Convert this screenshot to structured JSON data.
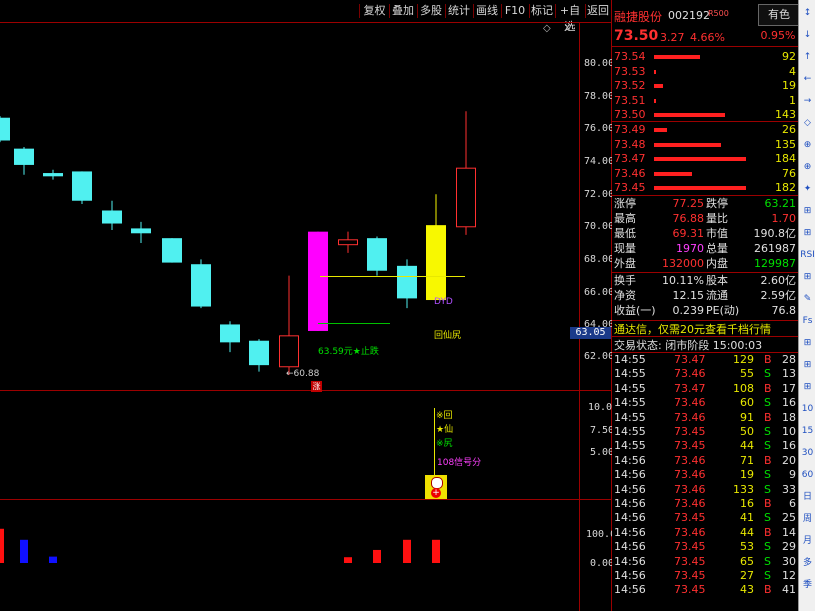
{
  "toolbar": {
    "items": [
      "复权",
      "叠加",
      "多股",
      "统计",
      "画线",
      "F10",
      "标记",
      "+自选",
      "返回"
    ],
    "diamond": "◇",
    "close": "X"
  },
  "price_axis": {
    "ticks": [
      "80.00",
      "78.00",
      "76.00",
      "74.00",
      "72.00",
      "70.00",
      "68.00",
      "66.00",
      "64.00",
      "62.00"
    ],
    "current_tag": "63.05"
  },
  "indicator_axis": {
    "ticks": [
      "10.00",
      "7.50",
      "5.00"
    ]
  },
  "volume_axis": {
    "ticks": [
      "100.0",
      "0.00"
    ]
  },
  "annotations": {
    "low_price": "←60.88",
    "zhang": "涨",
    "stop_label": "63.59元★止跌",
    "pattern_label": "回仙尻",
    "dyd": "DYD",
    "signal_lines": [
      "※回",
      "★仙",
      "※尻"
    ],
    "signal_count": "108信号分"
  },
  "chart_data": {
    "type": "candlestick",
    "yrange": [
      60.5,
      81.5
    ],
    "candles": [
      {
        "open": 75.3,
        "close": 76.7,
        "high": 76.8,
        "low": 75.2,
        "color": "cyan"
      },
      {
        "open": 74.8,
        "close": 73.8,
        "high": 74.9,
        "low": 73.2,
        "color": "cyan"
      },
      {
        "open": 73.3,
        "close": 73.1,
        "high": 73.5,
        "low": 72.9,
        "color": "cyan"
      },
      {
        "open": 73.4,
        "close": 71.6,
        "high": 73.4,
        "low": 71.4,
        "color": "cyan"
      },
      {
        "open": 71.0,
        "close": 70.2,
        "high": 71.6,
        "low": 69.8,
        "color": "cyan"
      },
      {
        "open": 69.9,
        "close": 69.6,
        "high": 70.3,
        "low": 69.0,
        "color": "cyan"
      },
      {
        "open": 69.3,
        "close": 67.8,
        "high": 69.3,
        "low": 67.8,
        "color": "cyan"
      },
      {
        "open": 67.7,
        "close": 65.1,
        "high": 68.0,
        "low": 65.0,
        "color": "cyan"
      },
      {
        "open": 64.0,
        "close": 62.9,
        "high": 64.2,
        "low": 62.3,
        "color": "cyan"
      },
      {
        "open": 63.0,
        "close": 61.5,
        "high": 63.1,
        "low": 61.1,
        "color": "cyan"
      },
      {
        "open": 61.4,
        "close": 63.3,
        "high": 67.0,
        "low": 60.9,
        "color": "red-hollow"
      },
      {
        "open": 63.6,
        "close": 69.7,
        "high": 69.7,
        "low": 63.6,
        "color": "magenta"
      },
      {
        "open": 69.2,
        "close": 68.9,
        "high": 69.7,
        "low": 68.4,
        "color": "red-hollow"
      },
      {
        "open": 69.3,
        "close": 67.3,
        "high": 69.4,
        "low": 67.0,
        "color": "cyan"
      },
      {
        "open": 67.6,
        "close": 65.6,
        "high": 68.0,
        "low": 65.0,
        "color": "cyan"
      },
      {
        "open": 65.5,
        "close": 70.1,
        "high": 72.0,
        "low": 65.5,
        "color": "yellow"
      },
      {
        "open": 70.0,
        "close": 73.6,
        "high": 77.1,
        "low": 69.5,
        "color": "red-hollow"
      }
    ],
    "volume": [
      {
        "index": 0,
        "value": 118,
        "color": "red"
      },
      {
        "index": 1,
        "value": 80,
        "color": "blue"
      },
      {
        "index": 2,
        "value": 22,
        "color": "blue"
      },
      {
        "index": 12,
        "value": 20,
        "color": "red"
      },
      {
        "index": 13,
        "value": 45,
        "color": "red"
      },
      {
        "index": 14,
        "value": 80,
        "color": "red"
      },
      {
        "index": 15,
        "value": 80,
        "color": "red"
      }
    ]
  },
  "quote": {
    "name": "融捷股份",
    "code": "002192",
    "rtag": "R500",
    "tag_btn": "有色",
    "price": "73.50",
    "change": "3.27",
    "pct": "4.66%",
    "tag_pct": "0.95%"
  },
  "sell": [
    {
      "p": "73.54",
      "v": "92",
      "w": 0.4
    },
    {
      "p": "73.53",
      "v": "4",
      "w": 0.02
    },
    {
      "p": "73.52",
      "v": "19",
      "w": 0.08
    },
    {
      "p": "73.51",
      "v": "1",
      "w": 0.01
    },
    {
      "p": "73.50",
      "v": "143",
      "w": 0.62
    }
  ],
  "buy": [
    {
      "p": "73.49",
      "v": "26",
      "w": 0.11
    },
    {
      "p": "73.48",
      "v": "135",
      "w": 0.58
    },
    {
      "p": "73.47",
      "v": "184",
      "w": 0.8
    },
    {
      "p": "73.46",
      "v": "76",
      "w": 0.33
    },
    {
      "p": "73.45",
      "v": "182",
      "w": 0.8
    }
  ],
  "stats": [
    {
      "l1": "涨停",
      "v1": "77.25",
      "c1": "red",
      "l2": "跌停",
      "v2": "63.21",
      "c2": "grn"
    },
    {
      "l1": "最高",
      "v1": "76.88",
      "c1": "red",
      "l2": "量比",
      "v2": "1.70",
      "c2": "red"
    },
    {
      "l1": "最低",
      "v1": "69.31",
      "c1": "red",
      "l2": "市值",
      "v2": "190.8亿",
      "c2": "wht"
    },
    {
      "l1": "现量",
      "v1": "1970",
      "c1": "mag",
      "l2": "总量",
      "v2": "261987",
      "c2": "wht"
    },
    {
      "l1": "外盘",
      "v1": "132000",
      "c1": "red",
      "l2": "内盘",
      "v2": "129987",
      "c2": "grn"
    }
  ],
  "stats2": [
    {
      "l1": "换手",
      "v1": "10.11%",
      "l2": "股本",
      "v2": "2.60亿"
    },
    {
      "l1": "净资",
      "v1": "12.15",
      "l2": "流通",
      "v2": "2.59亿"
    },
    {
      "l1": "收益(一)",
      "v1": "0.239",
      "l2": "PE(动)",
      "v2": "76.8"
    }
  ],
  "banner": "通达信，仅需20元查看千档行情",
  "status": "交易状态: 闭市阶段 15:00:03",
  "ticks": [
    {
      "t": "14:55",
      "p": "73.47",
      "v": "129",
      "s": "B",
      "n": "28"
    },
    {
      "t": "14:55",
      "p": "73.46",
      "v": "55",
      "s": "S",
      "n": "13"
    },
    {
      "t": "14:55",
      "p": "73.47",
      "v": "108",
      "s": "B",
      "n": "17"
    },
    {
      "t": "14:55",
      "p": "73.46",
      "v": "60",
      "s": "S",
      "n": "16"
    },
    {
      "t": "14:55",
      "p": "73.46",
      "v": "91",
      "s": "B",
      "n": "18"
    },
    {
      "t": "14:55",
      "p": "73.45",
      "v": "50",
      "s": "S",
      "n": "10"
    },
    {
      "t": "14:55",
      "p": "73.45",
      "v": "44",
      "s": "S",
      "n": "16"
    },
    {
      "t": "14:56",
      "p": "73.46",
      "v": "71",
      "s": "B",
      "n": "20"
    },
    {
      "t": "14:56",
      "p": "73.46",
      "v": "19",
      "s": "S",
      "n": "9"
    },
    {
      "t": "14:56",
      "p": "73.46",
      "v": "133",
      "s": "S",
      "n": "33"
    },
    {
      "t": "14:56",
      "p": "73.46",
      "v": "16",
      "s": "B",
      "n": "6"
    },
    {
      "t": "14:56",
      "p": "73.45",
      "v": "41",
      "s": "S",
      "n": "25"
    },
    {
      "t": "14:56",
      "p": "73.46",
      "v": "44",
      "s": "B",
      "n": "14"
    },
    {
      "t": "14:56",
      "p": "73.45",
      "v": "53",
      "s": "S",
      "n": "29"
    },
    {
      "t": "14:56",
      "p": "73.45",
      "v": "65",
      "s": "S",
      "n": "30"
    },
    {
      "t": "14:56",
      "p": "73.45",
      "v": "27",
      "s": "S",
      "n": "12"
    },
    {
      "t": "14:56",
      "p": "73.45",
      "v": "43",
      "s": "B",
      "n": "41"
    }
  ],
  "sidebar": [
    "↕",
    "↓",
    "↑",
    "←",
    "→",
    "◇",
    "⊕",
    "⊕",
    "✦",
    "⊞",
    "⊞",
    "RSI",
    "⊞",
    "✎",
    "Fs",
    "⊞",
    "⊞",
    "⊞",
    "10",
    "15",
    "30",
    "60",
    "日",
    "周",
    "月",
    "多",
    "季"
  ]
}
